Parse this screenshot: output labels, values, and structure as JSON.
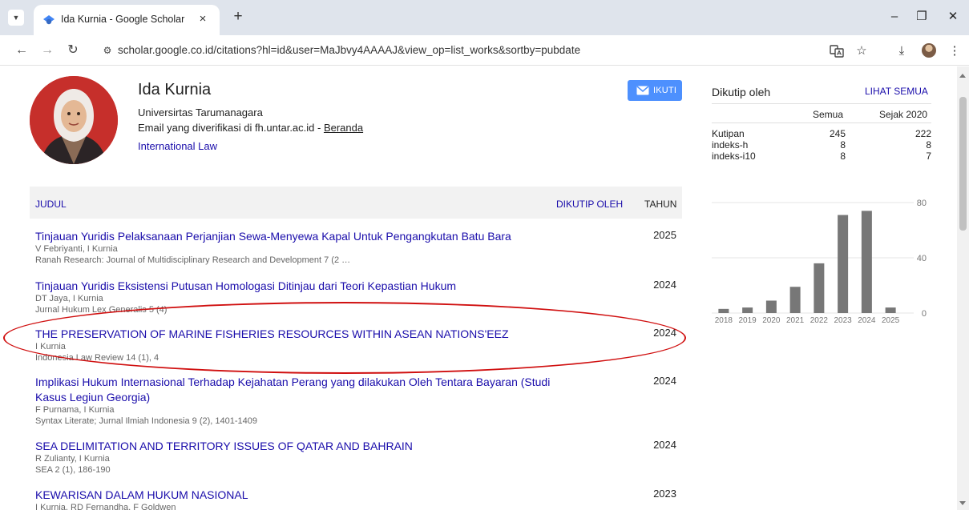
{
  "browser": {
    "tab_title": "Ida Kurnia - Google Scholar",
    "tab_close": "×",
    "new_tab": "+",
    "url": "scholar.google.co.id/citations?hl=id&user=MaJbvy4AAAAJ&view_op=list_works&sortby=pubdate",
    "icons": [
      "tab-search-icon",
      "back-arrow-icon",
      "forward-arrow-icon",
      "reload-icon",
      "site-info-icon",
      "translate-icon",
      "bookmark-star-icon",
      "download-icon",
      "profile-avatar",
      "kebab-menu-icon",
      "minimize-icon",
      "restore-icon",
      "close-icon"
    ]
  },
  "profile": {
    "name": "Ida Kurnia",
    "affiliation": "Universirtas Tarumanagara",
    "email_text": "Email yang diverifikasi di fh.untar.ac.id - ",
    "homepage_label": "Beranda",
    "interest": "International Law",
    "follow_label": "IKUTI"
  },
  "table": {
    "col_title": "JUDUL",
    "col_cited": "DIKUTIP OLEH",
    "col_year": "TAHUN"
  },
  "articles": [
    {
      "title": "Tinjauan Yuridis Pelaksanaan Perjanjian Sewa-Menyewa Kapal Untuk Pengangkutan Batu Bara",
      "authors": "V Febriyanti, I Kurnia",
      "venue": "Ranah Research: Journal of Multidisciplinary Research and Development 7 (2 …",
      "year": "2025"
    },
    {
      "title": "Tinjauan Yuridis Eksistensi Putusan Homologasi Ditinjau dari Teori Kepastian Hukum",
      "authors": "DT Jaya, I Kurnia",
      "venue": "Jurnal Hukum Lex Generalis 5 (4)",
      "year": "2024"
    },
    {
      "title": "THE PRESERVATION OF MARINE FISHERIES RESOURCES WITHIN ASEAN NATIONS'EEZ",
      "authors": "I Kurnia",
      "venue": "Indonesia Law Review 14 (1), 4",
      "year": "2024"
    },
    {
      "title": "Implikasi Hukum Internasional Terhadap Kejahatan Perang yang dilakukan Oleh Tentara Bayaran (Studi Kasus Legiun Georgia)",
      "authors": "F Purnama, I Kurnia",
      "venue": "Syntax Literate; Jurnal Ilmiah Indonesia 9 (2), 1401-1409",
      "year": "2024"
    },
    {
      "title": "SEA DELIMITATION AND TERRITORY ISSUES OF QATAR AND BAHRAIN",
      "authors": "R Zulianty, I Kurnia",
      "venue": "SEA 2 (1), 186-190",
      "year": "2024"
    },
    {
      "title": "KEWARISAN DALAM HUKUM NASIONAL",
      "authors": "I Kurnia, RD Fernandha, F Goldwen",
      "venue": "",
      "year": "2023"
    }
  ],
  "sidebar": {
    "cited_by_title": "Dikutip oleh",
    "see_all_label": "LIHAT SEMUA",
    "col_all": "Semua",
    "col_since": "Sejak 2020",
    "metrics": [
      {
        "label": "Kutipan",
        "all": "245",
        "since": "222"
      },
      {
        "label": "indeks-h",
        "all": "8",
        "since": "8"
      },
      {
        "label": "indeks-i10",
        "all": "8",
        "since": "7"
      }
    ]
  },
  "chart_data": {
    "type": "bar",
    "categories": [
      "2018",
      "2019",
      "2020",
      "2021",
      "2022",
      "2023",
      "2024",
      "2025"
    ],
    "values": [
      3,
      4,
      9,
      19,
      36,
      71,
      74,
      4
    ],
    "ylim": [
      0,
      80
    ],
    "yticks": [
      0,
      40,
      80
    ],
    "grid": true,
    "bar_color": "#777777"
  }
}
